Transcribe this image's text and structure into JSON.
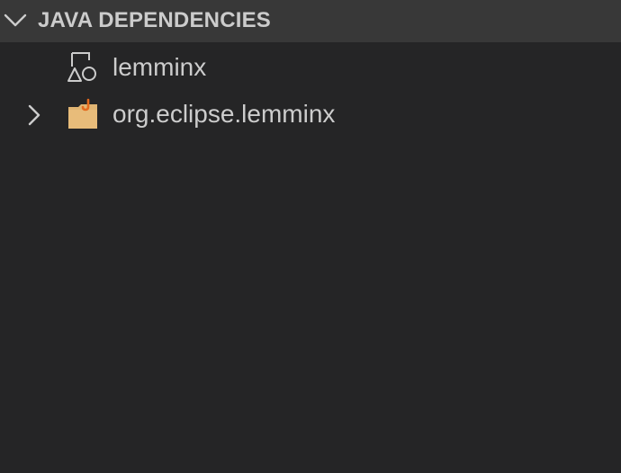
{
  "panel": {
    "header": {
      "title": "JAVA DEPENDENCIES",
      "expanded": true,
      "icon": "chevron-down-icon"
    },
    "items": [
      {
        "label": "lemminx",
        "icon": "project-icon",
        "expandable": false
      },
      {
        "label": "org.eclipse.lemminx",
        "icon": "java-package-icon",
        "expandable": true,
        "expanded": false
      }
    ]
  },
  "colors": {
    "background": "#252526",
    "header_background": "#383838",
    "text": "#cccccc",
    "folder": "#e0b472",
    "java_accent": "#e36a1e"
  }
}
